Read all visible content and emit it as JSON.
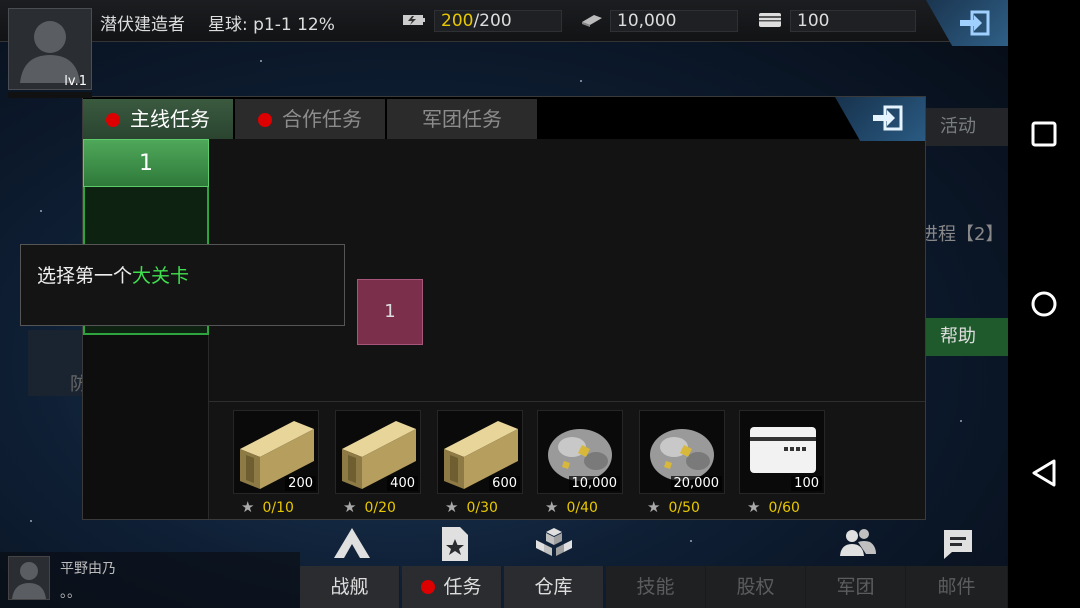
{
  "player": {
    "name": "潜伏建造者",
    "level": "lv.1",
    "planet": "星球: p1-1  12%"
  },
  "resources": {
    "energy_current": "200",
    "energy_max": "/200",
    "steel": "10,000",
    "credits": "100"
  },
  "side_buttons": {
    "activity": "活动",
    "progress": "进程【2】",
    "help": "帮助",
    "left_ghost": "防"
  },
  "dialog": {
    "tabs": [
      {
        "label": "主线任务",
        "dot": true
      },
      {
        "label": "合作任务",
        "dot": true
      },
      {
        "label": "军团任务",
        "dot": false
      }
    ],
    "stage": "1",
    "node": "1",
    "tooltip_prefix": "选择第一个",
    "tooltip_highlight": "大关卡",
    "rewards": [
      {
        "icon": "steel-beam-icon",
        "amount": "200",
        "progress": "0/10"
      },
      {
        "icon": "steel-beam-icon",
        "amount": "400",
        "progress": "0/20"
      },
      {
        "icon": "steel-beam-icon",
        "amount": "600",
        "progress": "0/30"
      },
      {
        "icon": "ore-icon",
        "amount": "10,000",
        "progress": "0/40"
      },
      {
        "icon": "ore-icon",
        "amount": "20,000",
        "progress": "0/50"
      },
      {
        "icon": "card-icon",
        "amount": "100",
        "progress": "0/60"
      }
    ]
  },
  "bottom_nav": [
    {
      "label": "战舰",
      "dim": false
    },
    {
      "label": "任务",
      "dim": false,
      "dot": true
    },
    {
      "label": "仓库",
      "dim": false
    },
    {
      "label": "技能",
      "dim": true
    },
    {
      "label": "股权",
      "dim": true
    },
    {
      "label": "军团",
      "dim": true
    },
    {
      "label": "邮件",
      "dim": true
    }
  ],
  "chat": {
    "name": "平野由乃",
    "message": "。。"
  },
  "colors": {
    "tab_active": "#3a5a3f",
    "highlight_green": "#3fe04e",
    "energy_yellow": "#e8c800",
    "node_magenta": "#7c2f4a",
    "red_dot": "#dd0000"
  }
}
